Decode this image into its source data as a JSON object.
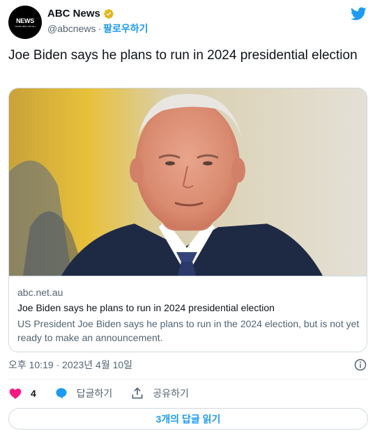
{
  "author": {
    "display_name": "ABC News",
    "handle": "@abcnews",
    "follow_label": "팔로우하기",
    "separator": "·",
    "avatar_logo": "NEWS",
    "avatar_subtext": "news.abc.net.au"
  },
  "tweet": {
    "text": "Joe Biden says he plans to run in 2024 presidential election"
  },
  "card": {
    "domain": "abc.net.au",
    "title": "Joe Biden says he plans to run in 2024 presidential election",
    "description": "US President Joe Biden says he plans to run in the 2024 election, but is not yet ready to make an announcement."
  },
  "timestamp": "오후 10:19 · 2023년 4월 10일",
  "actions": {
    "like_count": "4",
    "reply_label": "답글하기",
    "share_label": "공유하기"
  },
  "replies_button_label": "3개의 답글 읽기",
  "icons": {
    "twitter": "twitter-bird-icon",
    "verified": "verified-badge-icon",
    "heart": "heart-icon",
    "reply": "reply-bubble-icon",
    "share": "share-icon",
    "info": "info-icon"
  },
  "colors": {
    "accent": "#1d9bf0",
    "verified_gold": "#e2b719",
    "heart": "#f91880",
    "text_secondary": "#536471"
  }
}
